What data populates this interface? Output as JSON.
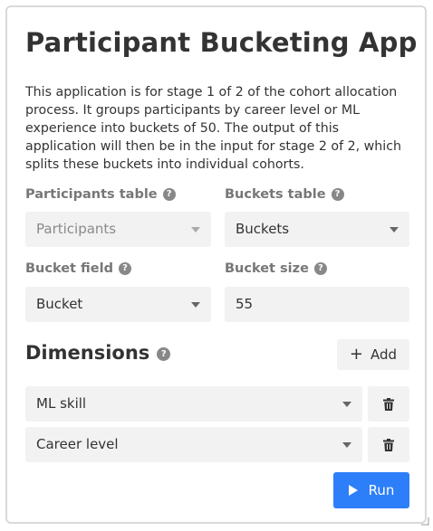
{
  "app": {
    "title": "Participant Bucketing App",
    "description": "This application is for stage 1 of 2 of the cohort allocation process. It groups participants by career level or ML experience into buckets of 50. The output of this application will then be in the input for stage 2 of 2, which splits these buckets into individual cohorts."
  },
  "fields": {
    "participants_table": {
      "label": "Participants table",
      "value": "Participants"
    },
    "buckets_table": {
      "label": "Buckets table",
      "value": "Buckets"
    },
    "bucket_field": {
      "label": "Bucket field",
      "value": "Bucket"
    },
    "bucket_size": {
      "label": "Bucket size",
      "value": "55"
    }
  },
  "dimensions": {
    "title": "Dimensions",
    "add_label": "Add",
    "items": [
      {
        "value": "ML skill"
      },
      {
        "value": "Career level"
      }
    ]
  },
  "run_label": "Run",
  "icons": {
    "help": "help-circle-icon",
    "dropdown": "chevron-down-icon",
    "trash": "trash-icon",
    "plus": "plus-icon",
    "play": "play-icon"
  },
  "colors": {
    "primary": "#2d7ff9",
    "field_bg": "#f2f2f2",
    "label": "#777777",
    "text": "#333333"
  }
}
